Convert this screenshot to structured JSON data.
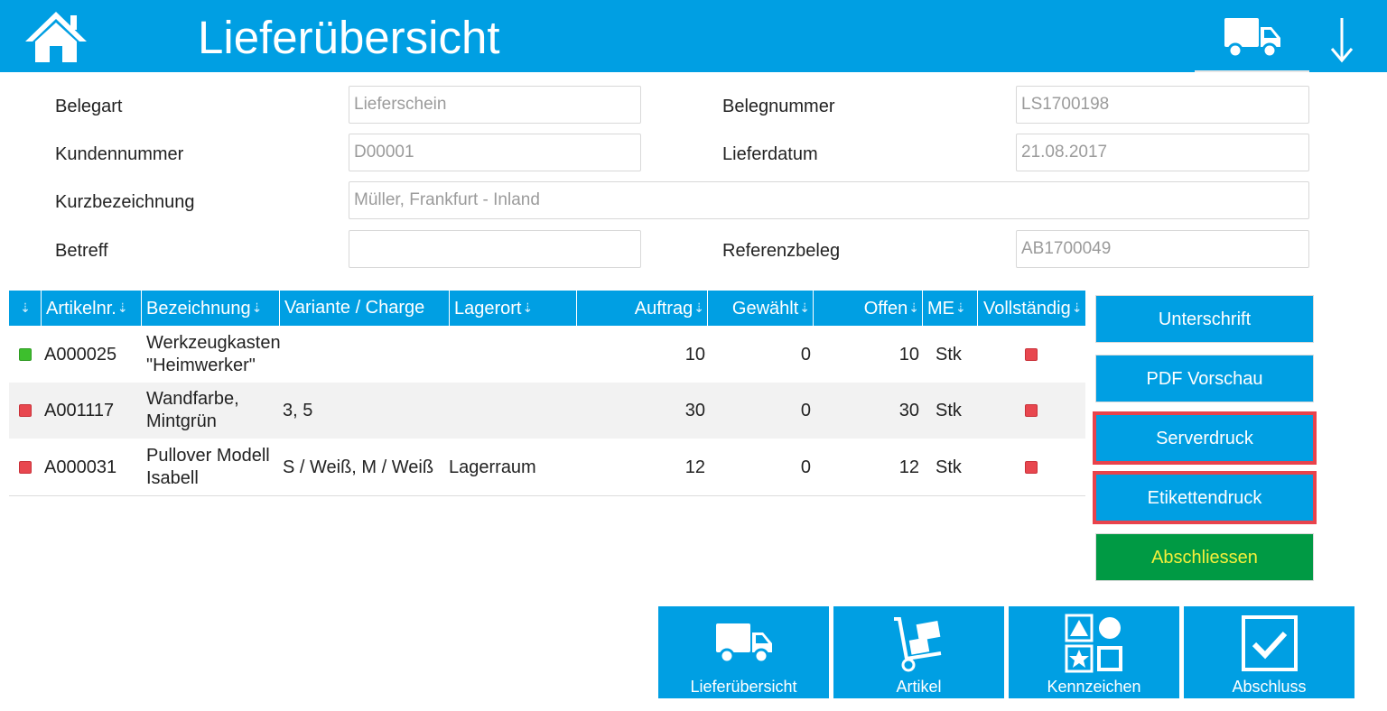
{
  "header": {
    "title": "Lieferübersicht",
    "icons": [
      "home-icon",
      "truck-icon",
      "arrow-down-icon"
    ],
    "color": "#009fe3"
  },
  "form": {
    "belegart_label": "Belegart",
    "belegart_value": "Lieferschein",
    "belegnummer_label": "Belegnummer",
    "belegnummer_value": "LS1700198",
    "kundennummer_label": "Kundennummer",
    "kundennummer_value": "D00001",
    "lieferdatum_label": "Lieferdatum",
    "lieferdatum_value": "21.08.2017",
    "kurzbezeichnung_label": "Kurzbezeichnung",
    "kurzbezeichnung_value": "Müller, Frankfurt - Inland",
    "betreff_label": "Betreff",
    "betreff_value": "",
    "referenzbeleg_label": "Referenzbeleg",
    "referenzbeleg_value": "AB1700049"
  },
  "table": {
    "sort_glyph": "⇣",
    "columns": {
      "artikelnr": "Artikelnr.",
      "bezeichnung": "Bezeichnung",
      "variante": "Variante / Charge",
      "lagerort": "Lagerort",
      "auftrag": "Auftrag",
      "gewaehlt": "Gewählt",
      "offen": "Offen",
      "me": "ME",
      "vollstaendig": "Vollständig"
    },
    "rows": [
      {
        "status": "green",
        "artikelnr": "A000025",
        "bezeichnung_1": "Werkzeugkasten",
        "bezeichnung_2": "\"Heimwerker\"",
        "variante": "",
        "lagerort": "",
        "auftrag": "10",
        "gewaehlt": "0",
        "offen": "10",
        "me": "Stk",
        "vollstaendig": "red"
      },
      {
        "status": "red",
        "artikelnr": "A001117",
        "bezeichnung_1": "Wandfarbe,",
        "bezeichnung_2": "Mintgrün",
        "variante": "3, 5",
        "lagerort": "",
        "auftrag": "30",
        "gewaehlt": "0",
        "offen": "30",
        "me": "Stk",
        "vollstaendig": "red"
      },
      {
        "status": "red",
        "artikelnr": "A000031",
        "bezeichnung_1": "Pullover Modell",
        "bezeichnung_2": "Isabell",
        "variante": "S / Weiß, M / Weiß",
        "lagerort": "Lagerraum",
        "auftrag": "12",
        "gewaehlt": "0",
        "offen": "12",
        "me": "Stk",
        "vollstaendig": "red"
      }
    ]
  },
  "actions": {
    "unterschrift": "Unterschrift",
    "pdf_vorschau": "PDF Vorschau",
    "serverdruck": "Serverdruck",
    "etikettendruck": "Etikettendruck",
    "abschliessen": "Abschliessen",
    "highlight_color": "#e8434c",
    "green_color": "#009a44"
  },
  "nav": {
    "lieferuebersicht": "Lieferübersicht",
    "artikel": "Artikel",
    "kennzeichen": "Kennzeichen",
    "abschluss": "Abschluss",
    "icons": [
      "truck-icon",
      "hand-truck-icon",
      "shapes-icon",
      "checkbox-icon"
    ]
  }
}
